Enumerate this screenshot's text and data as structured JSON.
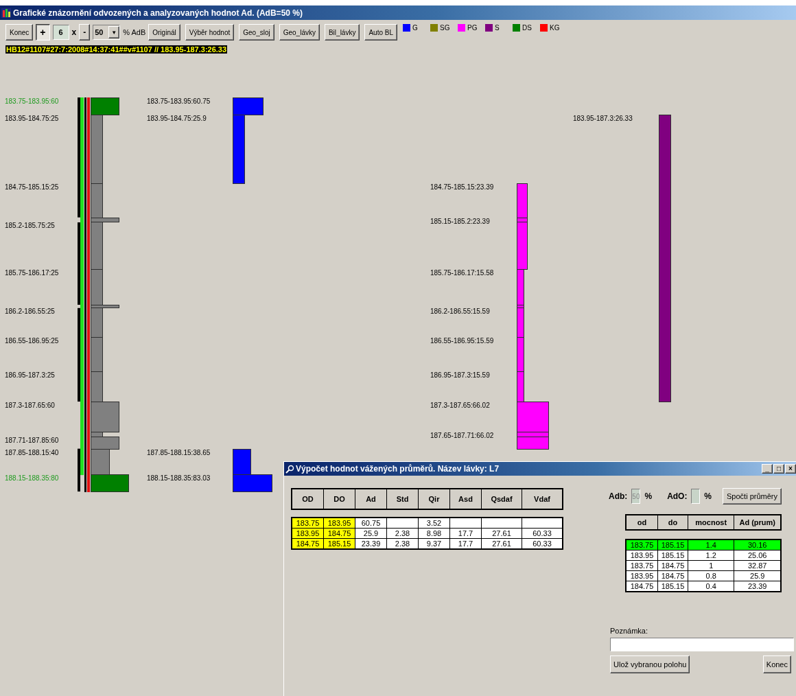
{
  "window": {
    "title": "Grafické znázornění odvozených a analyzovaných hodnot Ad.  (AdB=50 %)"
  },
  "toolbar": {
    "close_button": "Konec",
    "plus_toggle": {
      "label": "+",
      "pressed": true
    },
    "multiplier": "6",
    "times": "x",
    "minus_button": "-",
    "adb_combo": "50",
    "combo_arrow": "▼",
    "adb_unit": "% AdB",
    "buttons": [
      "Originál",
      "Výběr hodnot",
      "Geo_sloj",
      "Geo_lávky",
      "Bil_lávky",
      "Auto BL"
    ]
  },
  "legend": [
    {
      "label": "G",
      "color": "#0000ff"
    },
    {
      "label": "SG",
      "color": "#808000"
    },
    {
      "label": "PG",
      "color": "#ff00ff"
    },
    {
      "label": "S",
      "color": "#800080"
    },
    {
      "label": "DS",
      "color": "#008000"
    },
    {
      "label": "KG",
      "color": "#ff0000"
    }
  ],
  "status_text": "HB12#1107#27:7:2008#14:37:41##v#1107 // 183.95-187.3:26.33",
  "columns": [
    {
      "layers": [
        {
          "label": "183.75-183.95:60",
          "highlighted": true,
          "color": "#008000"
        },
        {
          "label": "183.95-184.75:25",
          "highlighted": false,
          "color": "#808080"
        },
        {
          "label": "184.75-185.15:25",
          "highlighted": false,
          "color": "#808080"
        },
        {
          "color": "#808080"
        },
        {
          "label": "185.2-185.75:25",
          "highlighted": false,
          "color": "#808080"
        },
        {
          "label": "185.75-186.17:25",
          "highlighted": false,
          "color": "#808080"
        },
        {
          "color": "#808080"
        },
        {
          "label": "186.2-186.55:25",
          "highlighted": false,
          "color": "#808080"
        },
        {
          "label": "186.55-186.95:25",
          "highlighted": false,
          "color": "#808080"
        },
        {
          "label": "186.95-187.3:25",
          "highlighted": false,
          "color": "#808080"
        },
        {
          "label": "187.3-187.65:60",
          "highlighted": false,
          "color": "#808080"
        },
        {
          "color": "#808080"
        },
        {
          "label": "187.71-187.85:60",
          "highlighted": false,
          "color": "#808080"
        },
        {
          "label": "187.85-188.15:40",
          "highlighted": false,
          "color": "#808080"
        },
        {
          "label": "188.15-188.35:80",
          "highlighted": true,
          "color": "#008000"
        }
      ]
    },
    {
      "layers": [
        {
          "label": "183.75-183.95:60.75",
          "highlighted": false,
          "color": "#0000ff"
        },
        {
          "label": "183.95-184.75:25.9",
          "highlighted": false,
          "color": "#0000ff"
        },
        {
          "label": "187.85-188.15:38.65",
          "highlighted": false,
          "color": "#0000ff"
        },
        {
          "label": "188.15-188.35:83.03",
          "highlighted": false,
          "color": "#0000ff"
        }
      ]
    },
    {
      "layers": [
        {
          "label": "184.75-185.15:23.39",
          "highlighted": false,
          "color": "#ff00ff"
        },
        {
          "label": "185.15-185.2:23.39",
          "highlighted": false,
          "color": "#ff00ff"
        },
        {
          "color": "#ff00ff"
        },
        {
          "label": "185.75-186.17:15.58",
          "highlighted": false,
          "color": "#ff00ff"
        },
        {
          "color": "#ff00ff"
        },
        {
          "label": "186.2-186.55:15.59",
          "highlighted": false,
          "color": "#ff00ff"
        },
        {
          "label": "186.55-186.95:15.59",
          "highlighted": false,
          "color": "#ff00ff"
        },
        {
          "label": "186.95-187.3:15.59",
          "highlighted": false,
          "color": "#ff00ff"
        },
        {
          "label": "187.3-187.65:66.02",
          "highlighted": false,
          "color": "#ff00ff"
        },
        {
          "label": "187.65-187.71:66.02",
          "highlighted": false,
          "color": "#ff00ff"
        },
        {
          "color": "#ff00ff"
        }
      ]
    },
    {
      "layers": [
        {
          "label": "183.95-187.3:26.33",
          "highlighted": false,
          "color": "#800080"
        }
      ]
    }
  ],
  "dialog": {
    "title": "Výpočet hodnot vážených průměrů. Název lávky:  L7",
    "window_buttons": [
      "_",
      "□",
      "×"
    ],
    "values_table": {
      "columns": [
        "OD",
        "DO",
        "Ad",
        "Std",
        "Qir",
        "Asd",
        "Qsdaf",
        "Vdaf"
      ],
      "rows": [
        [
          "183.75",
          "183.95",
          "60.75",
          "",
          "3.52",
          "",
          "",
          ""
        ],
        [
          "183.95",
          "184.75",
          "25.9",
          "2.38",
          "8.98",
          "17.7",
          "27.61",
          "60.33"
        ],
        [
          "184.75",
          "185.15",
          "23.39",
          "2.38",
          "9.37",
          "17.7",
          "27.61",
          "60.33"
        ]
      ]
    },
    "adb_label": "Adb:",
    "adb_value": "50",
    "adb_unit": "%",
    "ad0_label": "AdO:",
    "ad0_unit": "%",
    "compute_button": "Spočti průměry",
    "averages_table": {
      "columns": [
        "od",
        "do",
        "mocnost",
        "Ad (prum)"
      ],
      "rows": [
        {
          "cells": [
            "183.75",
            "185.15",
            "1.4",
            "30.16"
          ],
          "selected": true
        },
        {
          "cells": [
            "183.95",
            "185.15",
            "1.2",
            "25.06"
          ],
          "selected": false
        },
        {
          "cells": [
            "183.75",
            "184.75",
            "1",
            "32.87"
          ],
          "selected": false
        },
        {
          "cells": [
            "183.95",
            "184.75",
            "0.8",
            "25.9"
          ],
          "selected": false
        },
        {
          "cells": [
            "184.75",
            "185.15",
            "0.4",
            "23.39"
          ],
          "selected": false
        }
      ]
    },
    "note_label": "Poznámka:",
    "save_button": "Ulož vybranou polohu",
    "close_button": "Konec"
  }
}
